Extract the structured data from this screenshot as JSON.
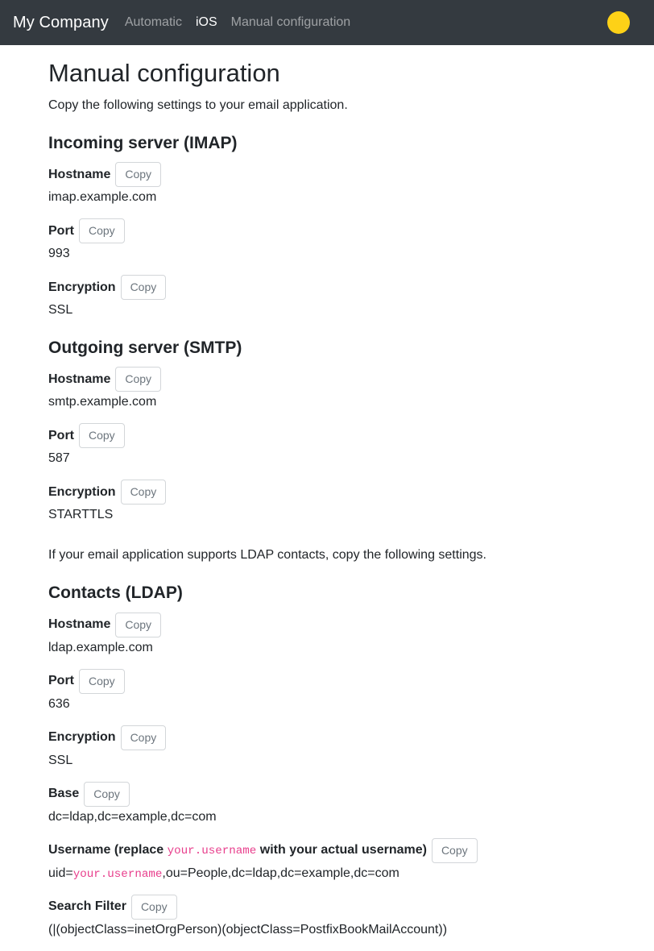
{
  "navbar": {
    "brand": "My Company",
    "links": [
      {
        "label": "Automatic",
        "active": false
      },
      {
        "label": "iOS",
        "active": true
      },
      {
        "label": "Manual configuration",
        "active": false
      }
    ],
    "avatar_color": "#fdd117"
  },
  "page": {
    "title": "Manual configuration",
    "lead": "Copy the following settings to your email application.",
    "ldap_note": "If your email application supports LDAP contacts, copy the following settings."
  },
  "copy_label": "Copy",
  "code_color": "#e83e8c",
  "sections": {
    "imap": {
      "title": "Incoming server (IMAP)",
      "hostname_label": "Hostname",
      "hostname_value": "imap.example.com",
      "port_label": "Port",
      "port_value": "993",
      "encryption_label": "Encryption",
      "encryption_value": "SSL"
    },
    "smtp": {
      "title": "Outgoing server (SMTP)",
      "hostname_label": "Hostname",
      "hostname_value": "smtp.example.com",
      "port_label": "Port",
      "port_value": "587",
      "encryption_label": "Encryption",
      "encryption_value": "STARTTLS"
    },
    "ldap": {
      "title": "Contacts (LDAP)",
      "hostname_label": "Hostname",
      "hostname_value": "ldap.example.com",
      "port_label": "Port",
      "port_value": "636",
      "encryption_label": "Encryption",
      "encryption_value": "SSL",
      "base_label": "Base",
      "base_value": "dc=ldap,dc=example,dc=com",
      "username_label_prefix": "Username (replace ",
      "username_label_code": "your.username",
      "username_label_suffix": " with your actual username)",
      "username_value_prefix": "uid=",
      "username_value_code": "your.username",
      "username_value_suffix": ",ou=People,dc=ldap,dc=example,dc=com",
      "search_filter_label": "Search Filter",
      "search_filter_value": "(|(objectClass=inetOrgPerson)(objectClass=PostfixBookMailAccount))"
    }
  }
}
